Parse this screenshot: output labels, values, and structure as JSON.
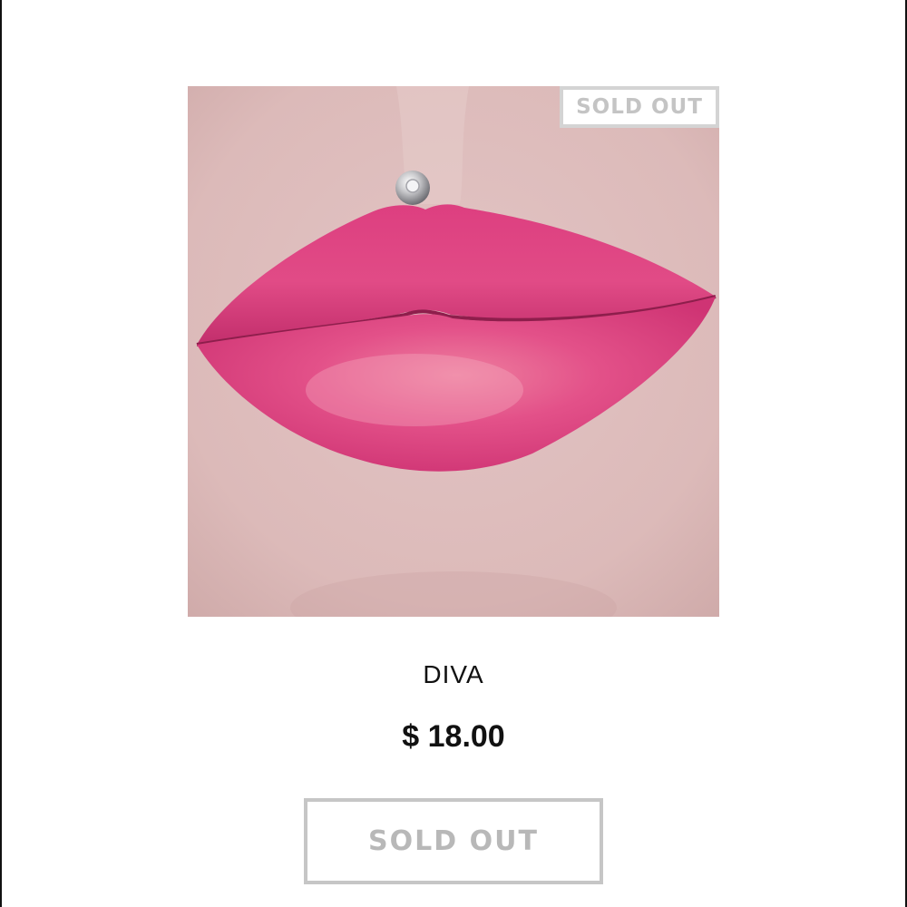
{
  "product": {
    "name": "DIVA",
    "price": "$ 18.00",
    "image_badge": "SOLD OUT",
    "image_alt": "",
    "button_label": "SOLD OUT"
  },
  "colors": {
    "lip_shade": "#e0407f",
    "badge_border": "#d4d4d4",
    "button_text": "#b8b8b8"
  },
  "icons": {
    "piercing": "lip-piercing-stud"
  }
}
